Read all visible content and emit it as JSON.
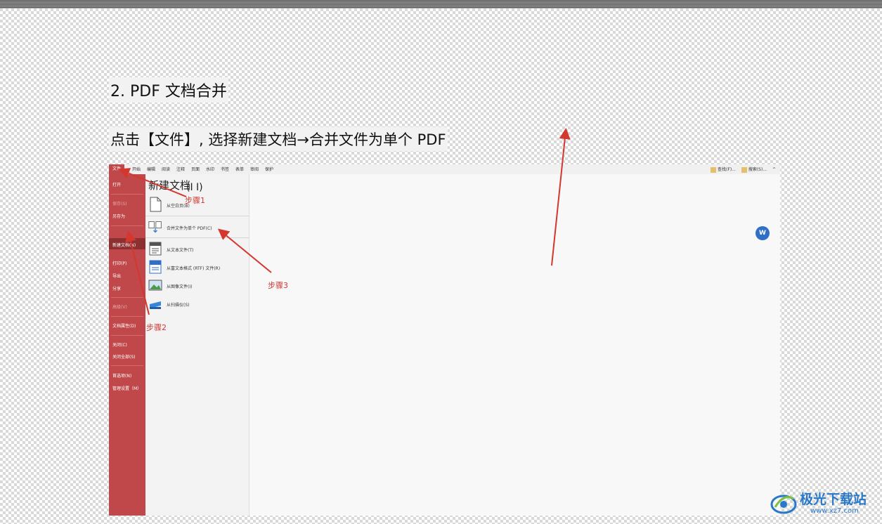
{
  "document": {
    "heading": "2. PDF 文档合并",
    "instruction": "点击【文件】, 选择新建文档→合并文件为单个 PDF"
  },
  "app": {
    "menu_tabs": [
      "文件",
      "开始",
      "编辑",
      "阅读",
      "注释",
      "页面",
      "水印",
      "书签",
      "表单",
      "审阅",
      "保护"
    ],
    "menu_right": [
      "查找(F)...",
      "搜索(S)...",
      "^"
    ],
    "sidebar": [
      {
        "label": "打开",
        "dim": false
      },
      {
        "label": "保存(S)",
        "dim": true
      },
      {
        "label": "另存为",
        "dim": false
      },
      {
        "label": "新建文档(N)",
        "dim": false,
        "selected": true
      },
      {
        "label": "打印(P)",
        "dim": false
      },
      {
        "label": "导出",
        "dim": false
      },
      {
        "label": "分享",
        "dim": false
      },
      {
        "label": "高级(V)",
        "dim": true
      },
      {
        "label": "文档属性(D)",
        "dim": false
      },
      {
        "label": "关闭(C)",
        "dim": false
      },
      {
        "label": "关闭全部(S)",
        "dim": false
      },
      {
        "label": "首选项(N)",
        "dim": false
      },
      {
        "label": "管理设置（M）",
        "dim": false
      }
    ],
    "panel_title": "新建文档",
    "panel_items": [
      {
        "label": "从空白页(B)",
        "icon": "blank-page-icon"
      },
      {
        "label": "合并文件为单个 PDF(C)",
        "icon": "merge-pdf-icon"
      },
      {
        "label": "从文本文件(T)",
        "icon": "text-file-icon"
      },
      {
        "label": "从富文本格式 (RTF) 文件(R)",
        "icon": "rtf-file-icon"
      },
      {
        "label": "从图像文件(I)",
        "icon": "image-file-icon"
      },
      {
        "label": "从扫描仪(S)",
        "icon": "scanner-icon"
      }
    ],
    "float_button": "W"
  },
  "annotations": {
    "step1": "步骤1",
    "step2": "步骤2",
    "step3": "步骤3",
    "title_suffix": "(I I)",
    "arrow_color": "#d3372e"
  },
  "watermark": {
    "name": "极光下载站",
    "url": "www.xz7.com"
  },
  "colors": {
    "sidebar": "#c0484a",
    "sidebar_selected": "#8e2f31",
    "accent_blue": "#2a78c8"
  }
}
